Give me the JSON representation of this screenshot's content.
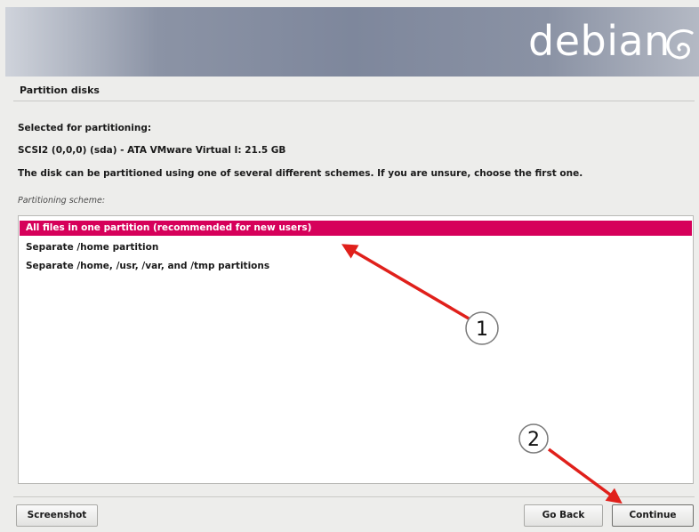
{
  "banner": {
    "logo_text": "debian"
  },
  "page": {
    "title": "Partition disks"
  },
  "content": {
    "selected_label": "Selected for partitioning:",
    "disk_name": "SCSI2 (0,0,0) (sda) - ATA VMware Virtual I: 21.5 GB",
    "description": "The disk can be partitioned using one of several different schemes. If you are unsure, choose the first one.",
    "scheme_label": "Partitioning scheme:"
  },
  "scheme_options": [
    {
      "label": "All files in one partition (recommended for new users)",
      "selected": true
    },
    {
      "label": "Separate /home partition",
      "selected": false
    },
    {
      "label": "Separate /home, /usr, /var, and /tmp partitions",
      "selected": false
    }
  ],
  "buttons": {
    "screenshot": "Screenshot",
    "go_back": "Go Back",
    "continue": "Continue"
  },
  "annotations": {
    "marker_1": "1",
    "marker_2": "2",
    "arrow_color": "#e0201b"
  },
  "colors": {
    "selection": "#d6005a"
  }
}
